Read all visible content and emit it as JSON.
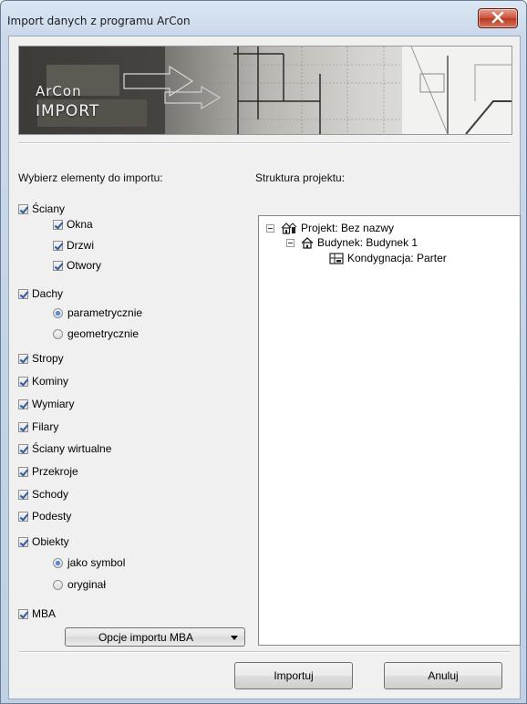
{
  "window": {
    "title": "Import danych z programu ArCon"
  },
  "banner": {
    "line1": "ArCon",
    "line2": "IMPORT"
  },
  "left_panel": {
    "heading": "Wybierz elementy do importu:",
    "walls": {
      "label": "Ściany",
      "checked": true,
      "children": [
        {
          "label": "Okna",
          "checked": true
        },
        {
          "label": "Drzwi",
          "checked": true
        },
        {
          "label": "Otwory",
          "checked": true
        }
      ]
    },
    "roofs": {
      "label": "Dachy",
      "checked": true,
      "options": [
        {
          "label": "parametrycznie",
          "selected": true
        },
        {
          "label": "geometrycznie",
          "selected": false
        }
      ]
    },
    "items": [
      {
        "label": "Stropy",
        "checked": true
      },
      {
        "label": "Kominy",
        "checked": true
      },
      {
        "label": "Wymiary",
        "checked": true
      },
      {
        "label": "Filary",
        "checked": true
      },
      {
        "label": "Ściany wirtualne",
        "checked": true
      },
      {
        "label": "Przekroje",
        "checked": true
      },
      {
        "label": "Schody",
        "checked": true
      },
      {
        "label": "Podesty",
        "checked": true
      }
    ],
    "objects": {
      "label": "Obiekty",
      "checked": true,
      "options": [
        {
          "label": "jako symbol",
          "selected": true
        },
        {
          "label": "oryginał",
          "selected": false
        }
      ]
    },
    "mba": {
      "label": "MBA",
      "checked": true,
      "dropdown_label": "Opcje importu MBA"
    }
  },
  "right_panel": {
    "heading": "Struktura projektu:",
    "tree": {
      "project": {
        "label": "Projekt: Bez nazwy",
        "icon": "project-icon"
      },
      "building": {
        "label": "Budynek: Budynek 1",
        "icon": "house-icon"
      },
      "floor": {
        "label": "Kondygnacja: Parter",
        "icon": "floor-icon"
      }
    }
  },
  "buttons": {
    "import_label": "Importuj",
    "cancel_label": "Anuluj"
  },
  "colors": {
    "check": "#2f5e9e",
    "close_button": "#c9503a",
    "title_bar": "#c9d8ea"
  }
}
